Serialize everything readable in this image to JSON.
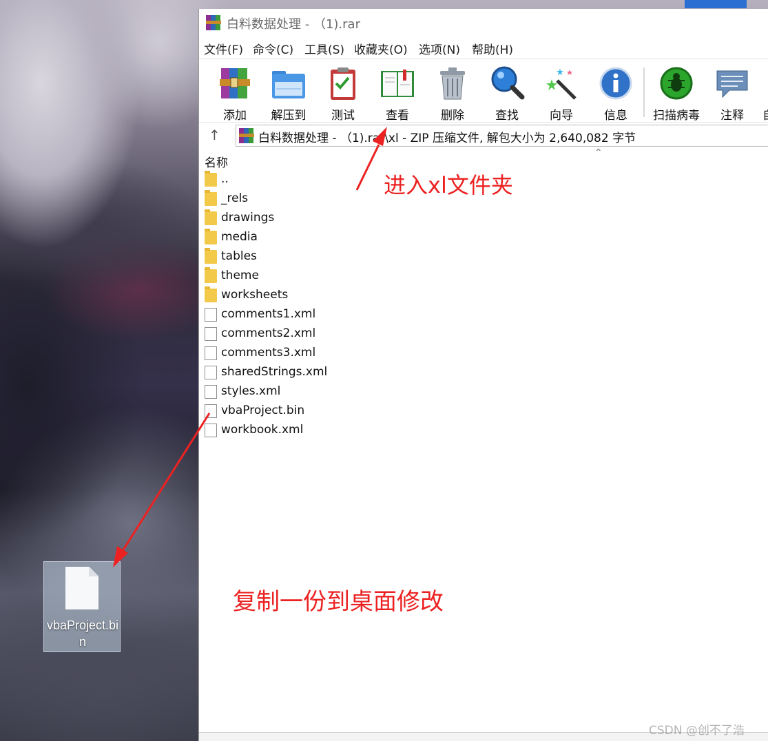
{
  "window": {
    "title": "白料数据处理 - （1).rar",
    "menu": [
      "文件(F)",
      "命令(C)",
      "工具(S)",
      "收藏夹(O)",
      "选项(N)",
      "帮助(H)"
    ],
    "toolbar": [
      {
        "label": "添加",
        "icon": "add-archive-icon"
      },
      {
        "label": "解压到",
        "icon": "extract-to-folder-icon"
      },
      {
        "label": "测试",
        "icon": "test-clipboard-icon"
      },
      {
        "label": "查看",
        "icon": "view-book-icon"
      },
      {
        "label": "删除",
        "icon": "trash-icon"
      },
      {
        "label": "查找",
        "icon": "magnifier-icon"
      },
      {
        "label": "向导",
        "icon": "magic-wand-icon"
      },
      {
        "label": "信息",
        "icon": "info-icon"
      },
      {
        "label": "扫描病毒",
        "icon": "virus-scan-icon"
      },
      {
        "label": "注释",
        "icon": "comment-icon"
      },
      {
        "label": "自",
        "icon": "partial-icon"
      }
    ],
    "address": "白料数据处理 - （1).rar\\xl - ZIP 压缩文件, 解包大小为 2,640,082 字节",
    "column_header": "名称",
    "files": [
      {
        "name": "..",
        "type": "folder"
      },
      {
        "name": "_rels",
        "type": "folder"
      },
      {
        "name": "drawings",
        "type": "folder"
      },
      {
        "name": "media",
        "type": "folder"
      },
      {
        "name": "tables",
        "type": "folder"
      },
      {
        "name": "theme",
        "type": "folder"
      },
      {
        "name": "worksheets",
        "type": "folder"
      },
      {
        "name": "comments1.xml",
        "type": "file"
      },
      {
        "name": "comments2.xml",
        "type": "file"
      },
      {
        "name": "comments3.xml",
        "type": "file"
      },
      {
        "name": "sharedStrings.xml",
        "type": "file"
      },
      {
        "name": "styles.xml",
        "type": "file"
      },
      {
        "name": "vbaProject.bin",
        "type": "file"
      },
      {
        "name": "workbook.xml",
        "type": "file"
      }
    ]
  },
  "desktop": {
    "icon_label": "vbaProject.bin"
  },
  "annotations": {
    "enter_xl": "进入xl文件夹",
    "copy_to_desktop": "复制一份到桌面修改",
    "color": "#ec2222"
  },
  "watermark": "CSDN @创不了浩"
}
